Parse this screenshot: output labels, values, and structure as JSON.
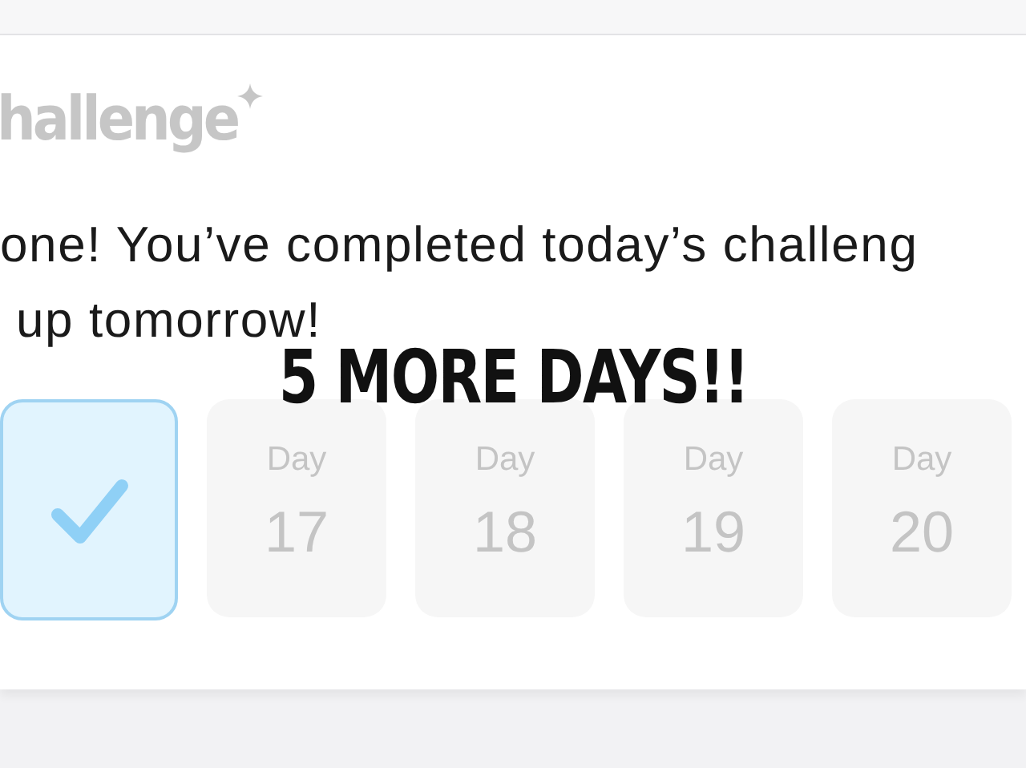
{
  "title": "hallenge",
  "message": [
    "one! You’ve completed today’s challeng",
    "up tomorrow!"
  ],
  "caption": "5 MORE DAYS!!",
  "days": [
    {
      "completed": true
    },
    {
      "completed": false,
      "label": "Day",
      "number": "17"
    },
    {
      "completed": false,
      "label": "Day",
      "number": "18"
    },
    {
      "completed": false,
      "label": "Day",
      "number": "19"
    },
    {
      "completed": false,
      "label": "Day",
      "number": "20"
    }
  ]
}
